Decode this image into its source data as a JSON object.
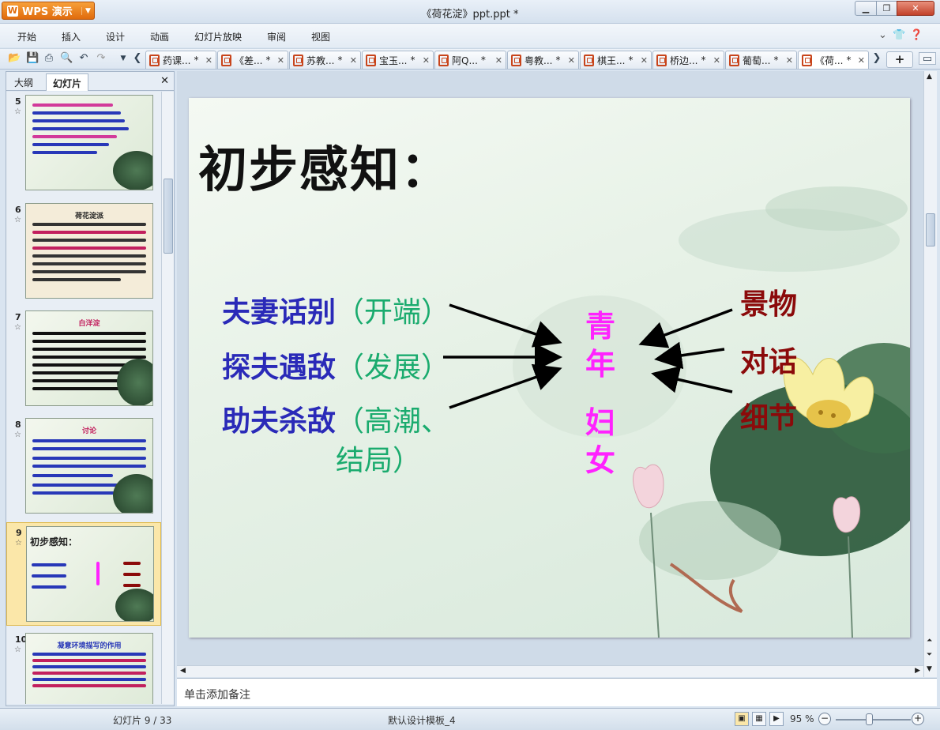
{
  "app": {
    "name": "WPS 演示",
    "document_title": "《荷花淀》ppt.ppt *"
  },
  "menu": [
    "开始",
    "插入",
    "设计",
    "动画",
    "幻灯片放映",
    "审阅",
    "视图"
  ],
  "tabs": [
    {
      "label": "药课...",
      "mod": "*"
    },
    {
      "label": "《差...",
      "mod": "*"
    },
    {
      "label": "苏教...",
      "mod": "*"
    },
    {
      "label": "宝玉...",
      "mod": "*"
    },
    {
      "label": "阿Q...",
      "mod": "*"
    },
    {
      "label": "粤教...",
      "mod": "*"
    },
    {
      "label": "棋王...",
      "mod": "*"
    },
    {
      "label": "桥边...",
      "mod": "*"
    },
    {
      "label": "葡萄...",
      "mod": "*"
    },
    {
      "label": "《荷...",
      "mod": "*"
    }
  ],
  "left_pane": {
    "tab_outline": "大纲",
    "tab_slides": "幻灯片",
    "thumbnails": [
      {
        "num": "5",
        "title": ""
      },
      {
        "num": "6",
        "title": "荷花淀派"
      },
      {
        "num": "7",
        "title": "白洋淀"
      },
      {
        "num": "8",
        "title": "讨论"
      },
      {
        "num": "9",
        "title": "初步感知："
      },
      {
        "num": "10",
        "title": "凝意环境描写的作用"
      }
    ]
  },
  "slide": {
    "title": "初步感知：",
    "plot": [
      {
        "name": "夫妻话别",
        "note": "（开端）"
      },
      {
        "name": "探夫遇敌",
        "note": "（发展）"
      },
      {
        "name": "助夫杀敌",
        "note": "（高潮、",
        "note2": "结局）"
      }
    ],
    "theme_chars": [
      "青",
      "年",
      "妇",
      "女"
    ],
    "elements": [
      "景物",
      "对话",
      "细节"
    ]
  },
  "notes_placeholder": "单击添加备注",
  "status": {
    "slide_counter": "幻灯片 9 / 33",
    "template": "默认设计模板_4",
    "zoom": "95 %"
  }
}
